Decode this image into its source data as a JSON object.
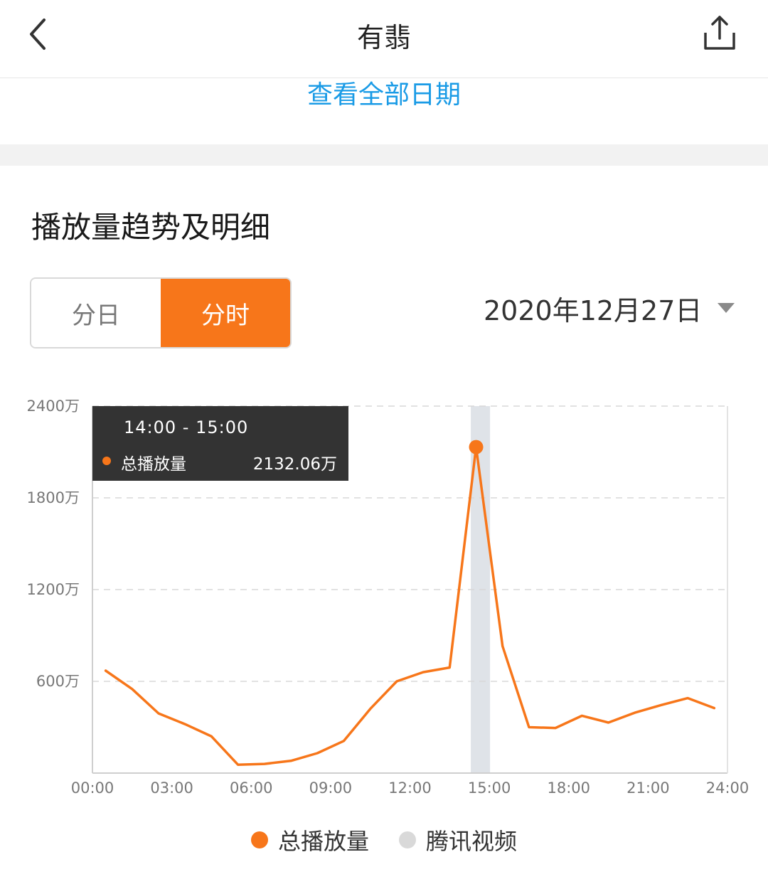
{
  "nav": {
    "title": "有翡",
    "back_icon": "chevron-left-icon",
    "share_icon": "share-icon"
  },
  "view_all_dates": "查看全部日期",
  "section_title": "播放量趋势及明细",
  "toggle": {
    "options": [
      "分日",
      "分时"
    ],
    "selected": "分时"
  },
  "date_selector": {
    "value": "2020年12月27日",
    "icon": "caret-down-icon"
  },
  "colors": {
    "accent": "#f7761a",
    "link": "#1a9be6",
    "secondary_series": "#d9d9d9",
    "highlight_band": "#dfe3e8",
    "tooltip_bg": "#333333"
  },
  "chart_data": {
    "type": "line",
    "title": "",
    "xlabel": "",
    "ylabel": "",
    "unit": "万",
    "x_ticks": [
      "00:00",
      "03:00",
      "06:00",
      "09:00",
      "12:00",
      "15:00",
      "18:00",
      "21:00",
      "24:00"
    ],
    "y_ticks": [
      "600万",
      "1200万",
      "1800万",
      "2400万"
    ],
    "xlim": [
      0,
      24
    ],
    "ylim": [
      0,
      2400
    ],
    "grid": true,
    "legend_position": "bottom-center",
    "series": [
      {
        "name": "总播放量",
        "x": [
          0.5,
          1.5,
          2.5,
          3.5,
          4.5,
          5.5,
          6.5,
          7.5,
          8.5,
          9.5,
          10.5,
          11.5,
          12.5,
          13.5,
          14.5,
          15.5,
          16.5,
          17.5,
          18.5,
          19.5,
          20.5,
          21.5,
          22.5,
          23.5
        ],
        "values": [
          670,
          550,
          390,
          320,
          240,
          55,
          60,
          80,
          130,
          210,
          420,
          600,
          660,
          690,
          2132.06,
          830,
          300,
          295,
          375,
          330,
          395,
          445,
          490,
          425
        ]
      },
      {
        "name": "腾讯视频",
        "x": [],
        "values": []
      }
    ],
    "highlight": {
      "range": "14:00 - 15:00",
      "series": "总播放量",
      "value_label": "2132.06万"
    }
  },
  "legend": [
    {
      "label": "总播放量",
      "color": "#f7761a"
    },
    {
      "label": "腾讯视频",
      "color": "#d9d9d9"
    }
  ]
}
